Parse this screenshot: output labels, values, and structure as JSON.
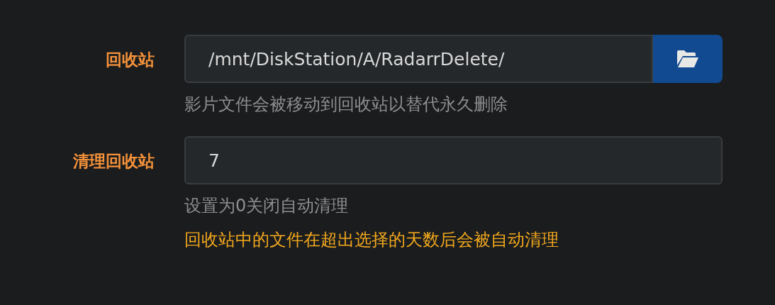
{
  "fields": [
    {
      "label": "回收站",
      "value": "/mnt/DiskStation/A/RadarrDelete/",
      "kind": "path",
      "help": [
        "影片文件会被移动到回收站以替代永久删除"
      ]
    },
    {
      "label": "清理回收站",
      "value": "7",
      "kind": "number",
      "help": [
        "设置为0关闭自动清理"
      ],
      "warning": [
        "回收站中的文件在超出选择的天数后会被自动清理"
      ]
    }
  ]
}
